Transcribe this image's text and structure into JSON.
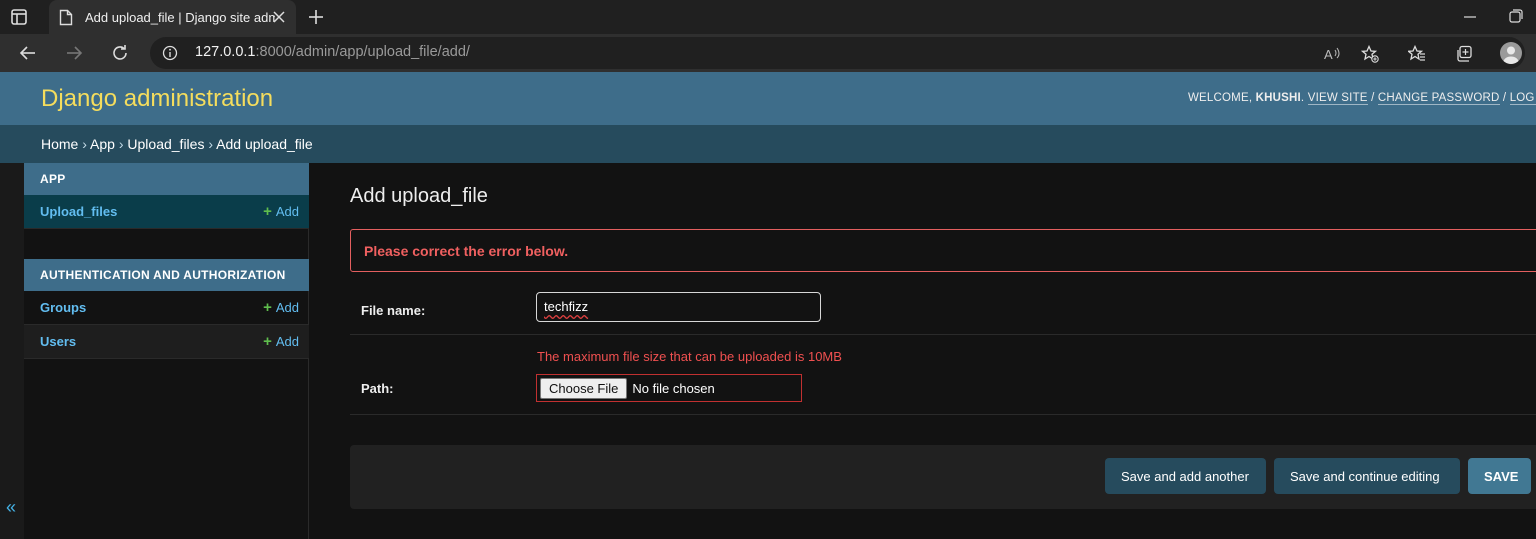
{
  "browser": {
    "tab_title": "Add upload_file | Django site admin",
    "url_host": "127.0.0.1",
    "url_rest": ":8000/admin/app/upload_file/add/",
    "icons": [
      "sidebar-icon",
      "document-icon",
      "close-icon",
      "plus-icon",
      "minimize-icon",
      "restore-icon",
      "back-icon",
      "forward-icon",
      "reload-icon",
      "info-icon",
      "read-aloud-icon",
      "favorite-add-icon",
      "favorites-icon",
      "collections-icon",
      "profile-icon"
    ]
  },
  "header": {
    "branding": "Django administration",
    "welcome": "WELCOME,",
    "username": "KHUSHI",
    "view_site": "VIEW SITE",
    "change_password": "CHANGE PASSWORD",
    "logout": "LOG OUT",
    "brand_color": "#f5dd5d",
    "header_bg": "#3e6d8a"
  },
  "breadcrumbs": {
    "home": "Home",
    "app": "App",
    "model": "Upload_files",
    "current": "Add upload_file",
    "sep": " › "
  },
  "sidebar": {
    "collapse_glyph": "«",
    "modules": [
      {
        "caption": "APP",
        "rows": [
          {
            "name": "Upload_files",
            "add": "Add"
          }
        ]
      },
      {
        "caption": "AUTHENTICATION AND AUTHORIZATION",
        "rows": [
          {
            "name": "Groups",
            "add": "Add"
          },
          {
            "name": "Users",
            "add": "Add"
          }
        ]
      }
    ]
  },
  "main": {
    "title": "Add upload_file",
    "errornote": "Please correct the error below.",
    "file_name_label": "File name:",
    "file_name_value": "techfizz",
    "path_error": "The maximum file size that can be uploaded is 10MB",
    "path_label": "Path:",
    "choose_file": "Choose File",
    "no_file": "No file chosen",
    "buttons": {
      "save_add": "Save and add another",
      "save_continue": "Save and continue editing",
      "save": "SAVE"
    },
    "error_color": "#f05050"
  }
}
